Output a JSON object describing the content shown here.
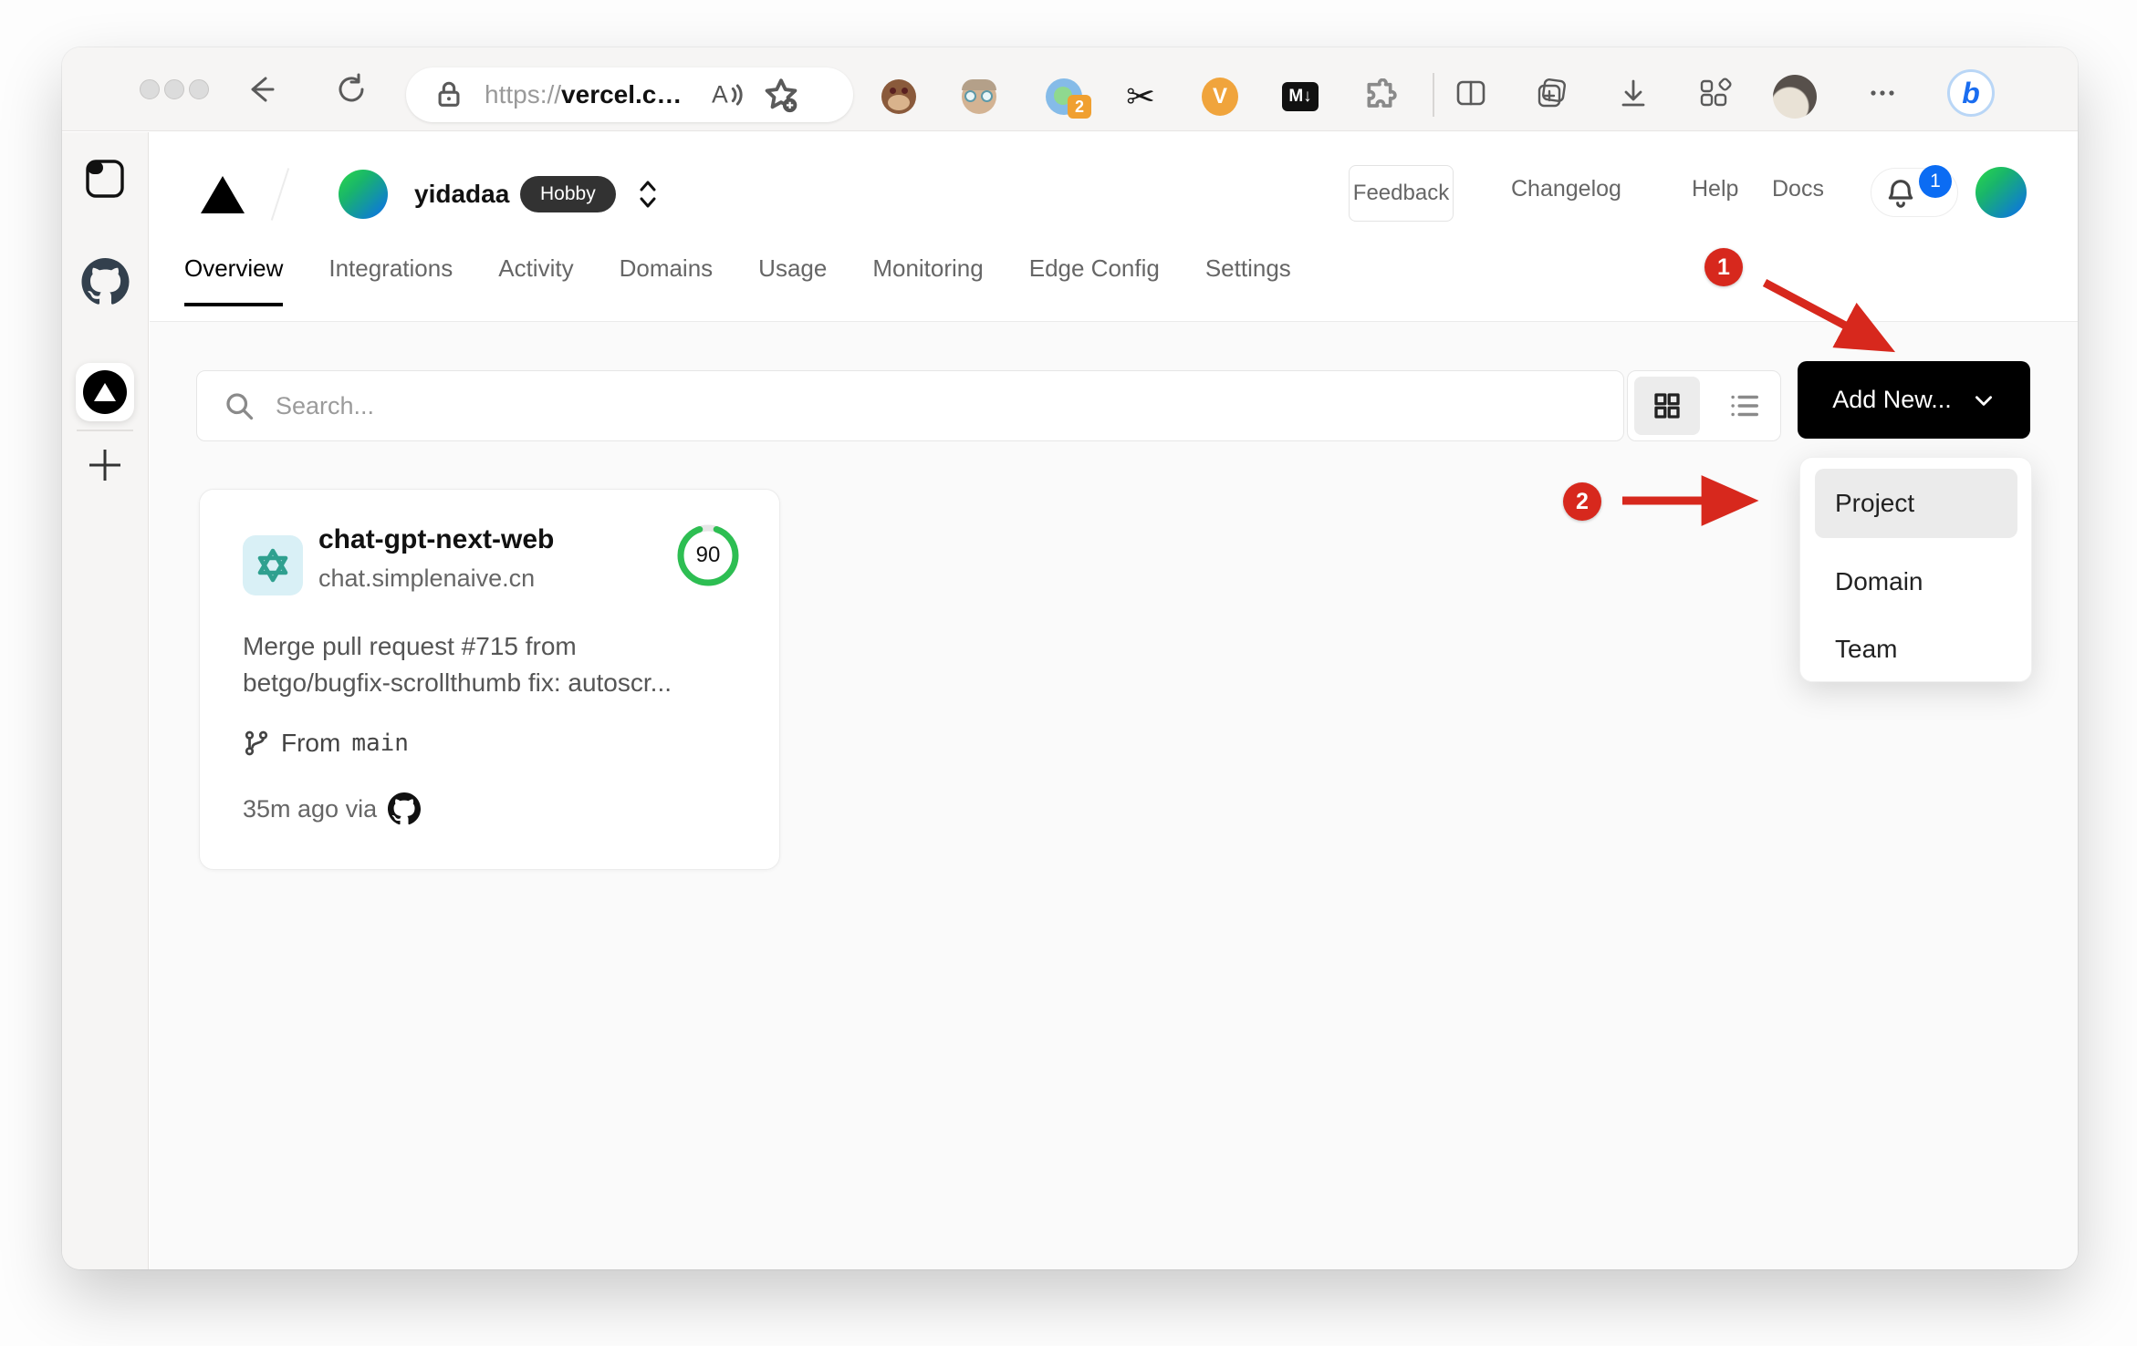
{
  "browser": {
    "url_scheme": "https://",
    "url_host": "vercel.c…",
    "extension_badge": "2",
    "scissors_glyph": "✂",
    "vc_label": "V",
    "markdown_label": "M↓"
  },
  "header": {
    "team_name": "yidadaa",
    "plan_badge": "Hobby",
    "feedback_label": "Feedback",
    "links": {
      "0": "Changelog",
      "1": "Help",
      "2": "Docs"
    },
    "notification_count": "1"
  },
  "tabs": {
    "0": "Overview",
    "1": "Integrations",
    "2": "Activity",
    "3": "Domains",
    "4": "Usage",
    "5": "Monitoring",
    "6": "Edge Config",
    "7": "Settings"
  },
  "toolbar": {
    "search_placeholder": "Search...",
    "add_new_label": "Add New..."
  },
  "dropdown": {
    "items": {
      "0": "Project",
      "1": "Domain",
      "2": "Team"
    },
    "highlighted": "Project"
  },
  "project_card": {
    "name": "chat-gpt-next-web",
    "domain": "chat.simplenaive.cn",
    "score": "90",
    "commit_line1": "Merge pull request #715 from",
    "commit_line2": "betgo/bugfix-scrollthumb fix: autoscr...",
    "branch_prefix": "From",
    "branch_name": "main",
    "deploy_meta": "35m ago via"
  },
  "annotations": {
    "step1": "1",
    "step2": "2"
  },
  "colors": {
    "annotation_red": "#d7281d",
    "score_green": "#2dbe52",
    "notification_blue": "#0b6cf3",
    "plan_badge_bg": "#323232",
    "accent_black": "#000000"
  }
}
